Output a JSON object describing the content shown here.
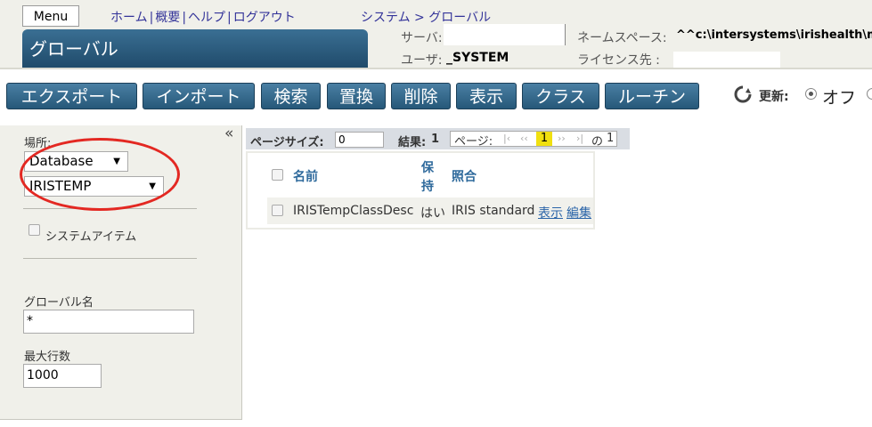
{
  "header": {
    "menu_label": "Menu",
    "links": [
      "ホーム",
      "概要",
      "ヘルプ",
      "ログアウト"
    ],
    "separator": "|",
    "breadcrumb_root": "システム",
    "breadcrumb_sep": ">",
    "breadcrumb_page": "グローバル",
    "title": "グローバル",
    "server_label": "サーバ:",
    "server_value": "",
    "user_label": "ユーザ:",
    "user_value": "_SYSTEM",
    "namespace_label": "ネームスペース:",
    "namespace_value": "^^c:\\intersystems\\irishealth\\mg",
    "license_label": "ライセンス先 :",
    "license_value": ""
  },
  "toolbar": {
    "buttons": [
      "エクスポート",
      "インポート",
      "検索",
      "置換",
      "削除",
      "表示",
      "クラス",
      "ルーチン"
    ],
    "refresh_label": "更新:",
    "refresh_off": "オフ",
    "refresh_selected": "off",
    "colors": {
      "button_top": "#4a7fa3",
      "button_bottom": "#265879"
    }
  },
  "sidebar": {
    "collapse": "«",
    "location_label": "場所:",
    "type_select": "Database",
    "db_select": "IRISTEMP",
    "system_items_label": "システムアイテム",
    "global_name_label": "グローバル名",
    "global_name_value": "*",
    "max_rows_label": "最大行数",
    "max_rows_value": "1000"
  },
  "table": {
    "page_size_label": "ページサイズ:",
    "page_size_value": "0",
    "results_label": "結果:",
    "results_value": "1",
    "page_label": "ページ:",
    "pager_first": "|‹",
    "pager_prev": "‹‹",
    "current_page": "1",
    "pager_next": "››",
    "pager_last": "›|",
    "of_label": "の",
    "total_pages": "1",
    "columns": [
      "名前",
      "保",
      "持",
      "照合"
    ],
    "rows": [
      {
        "name": "IRISTempClassDesc",
        "keep": "はい",
        "collation": "IRIS standard",
        "view": "表示",
        "edit": "編集"
      }
    ]
  },
  "annotation": {
    "color": "#e32822"
  }
}
